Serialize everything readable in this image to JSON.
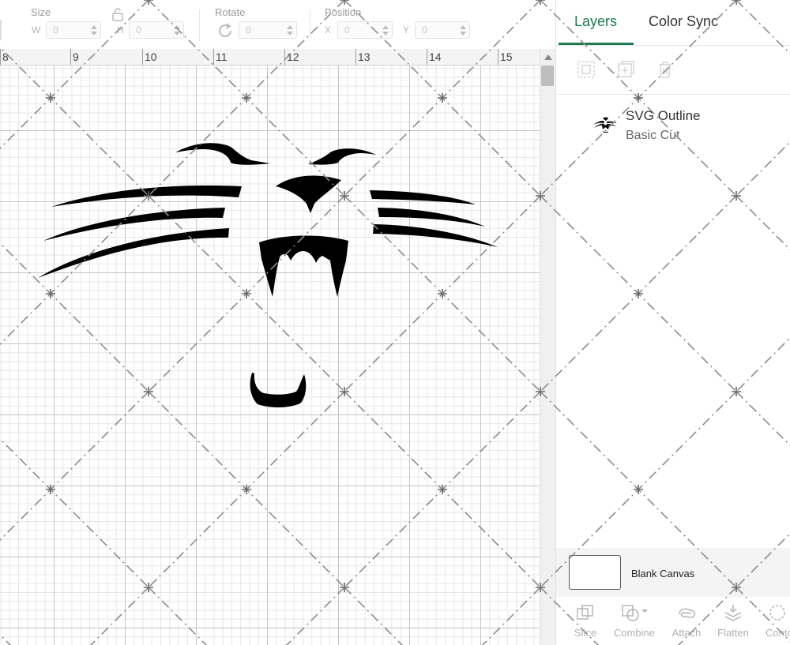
{
  "toolbar": {
    "size_label": "Size",
    "width_prefix": "W",
    "width_value": "0",
    "height_prefix": "H",
    "height_value": "0",
    "rotate_label": "Rotate",
    "rotate_value": "0",
    "position_label": "Position",
    "x_prefix": "X",
    "x_value": "0",
    "y_prefix": "Y",
    "y_value": "0"
  },
  "ruler": {
    "numbers": [
      "8",
      "9",
      "10",
      "11",
      "12",
      "13",
      "14",
      "15"
    ]
  },
  "panel": {
    "tabs": [
      {
        "label": "Layers",
        "active": true
      },
      {
        "label": "Color Sync",
        "active": false
      }
    ],
    "layer": {
      "name": "SVG Outline",
      "operation": "Basic Cut"
    },
    "blank_canvas_label": "Blank Canvas",
    "actions": [
      "Slice",
      "Combine",
      "Attach",
      "Flatten",
      "Conto"
    ]
  },
  "colors": {
    "accent": "#1b7a52",
    "design_fill": "#000000",
    "grid_major": "#c4c4c4",
    "grid_minor": "#e6e6e6"
  }
}
